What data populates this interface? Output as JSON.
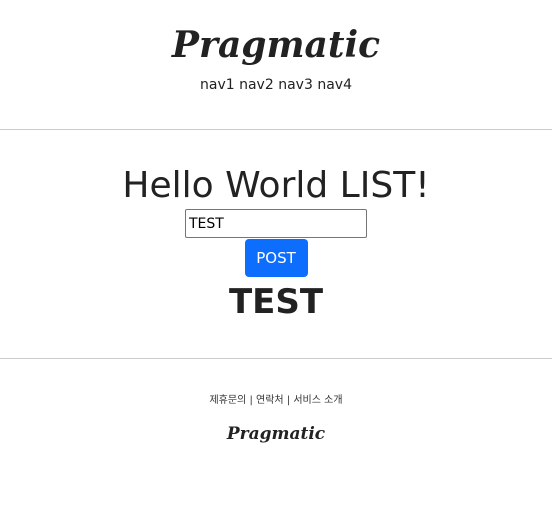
{
  "header": {
    "logo": "Pragmatic",
    "nav": [
      "nav1",
      "nav2",
      "nav3",
      "nav4"
    ]
  },
  "main": {
    "title": "Hello World LIST!",
    "input_value": "TEST",
    "post_label": "POST",
    "result": "TEST"
  },
  "footer": {
    "links": [
      "제휴문의",
      "연락처",
      "서비스 소개"
    ],
    "separator": "|",
    "logo": "Pragmatic"
  },
  "colors": {
    "primary": "#0d6efd",
    "divider": "#cccccc",
    "text": "#222222"
  }
}
